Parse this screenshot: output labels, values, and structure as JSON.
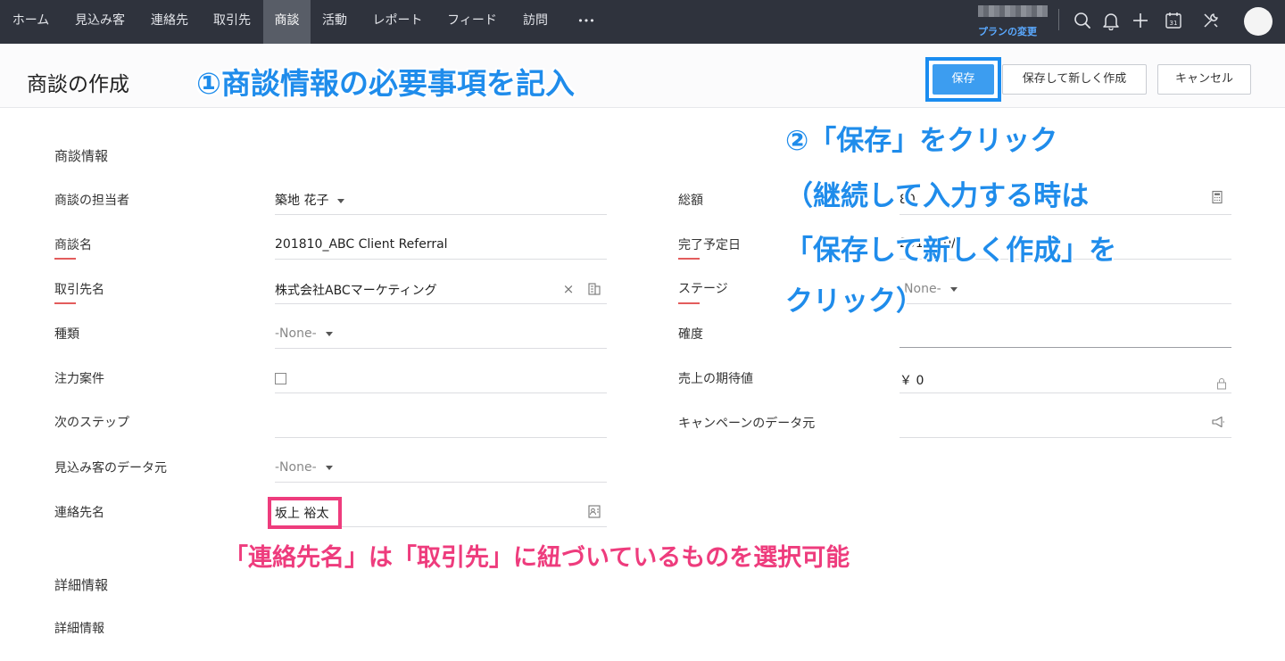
{
  "nav": {
    "items": [
      "ホーム",
      "見込み客",
      "連絡先",
      "取引先",
      "商談",
      "活動",
      "レポート",
      "フィード",
      "訪問"
    ],
    "more": "•••",
    "plan_link": "プランの変更",
    "icons": [
      "search-icon",
      "bell-icon",
      "plus-icon",
      "calendar-icon",
      "tools-icon",
      "avatar"
    ],
    "calendar_day": "31"
  },
  "header": {
    "title": "商談の作成",
    "save": "保存",
    "save_new": "保存して新しく作成",
    "cancel": "キャンセル"
  },
  "annotations": {
    "step1": "①商談情報の必要事項を記入",
    "step2_line1": "②「保存」をクリック",
    "step2_line2": "（継続して入力する時は",
    "step2_line3": "「保存して新しく作成」を",
    "step2_line4": "クリック）",
    "contact_note": "「連絡先名」は「取引先」に紐づいているものを選択可能"
  },
  "form": {
    "section_deal": "商談情報",
    "left": {
      "owner_label": "商談の担当者",
      "owner_value": "築地 花子",
      "name_label": "商談名",
      "name_value": "201810_ABC Client Referral",
      "account_label": "取引先名",
      "account_value": "株式会社ABCマーケティング",
      "type_label": "種類",
      "type_value": "-None-",
      "focus_label": "注力案件",
      "next_step_label": "次のステップ",
      "lead_source_label": "見込み客のデータ元",
      "lead_source_value": "-None-",
      "contact_label": "連絡先名",
      "contact_value": "坂上 裕太"
    },
    "right": {
      "amount_label": "総額",
      "amount_value": "80",
      "closing_label": "完了予定日",
      "closing_value": "2018/10/",
      "stage_label": "ステージ",
      "stage_value": "-None-",
      "probability_label": "確度",
      "expected_label": "売上の期待値",
      "expected_value": "￥ 0",
      "campaign_label": "キャンペーンのデータ元"
    },
    "section_detail": "詳細情報",
    "detail_label": "詳細情報"
  }
}
